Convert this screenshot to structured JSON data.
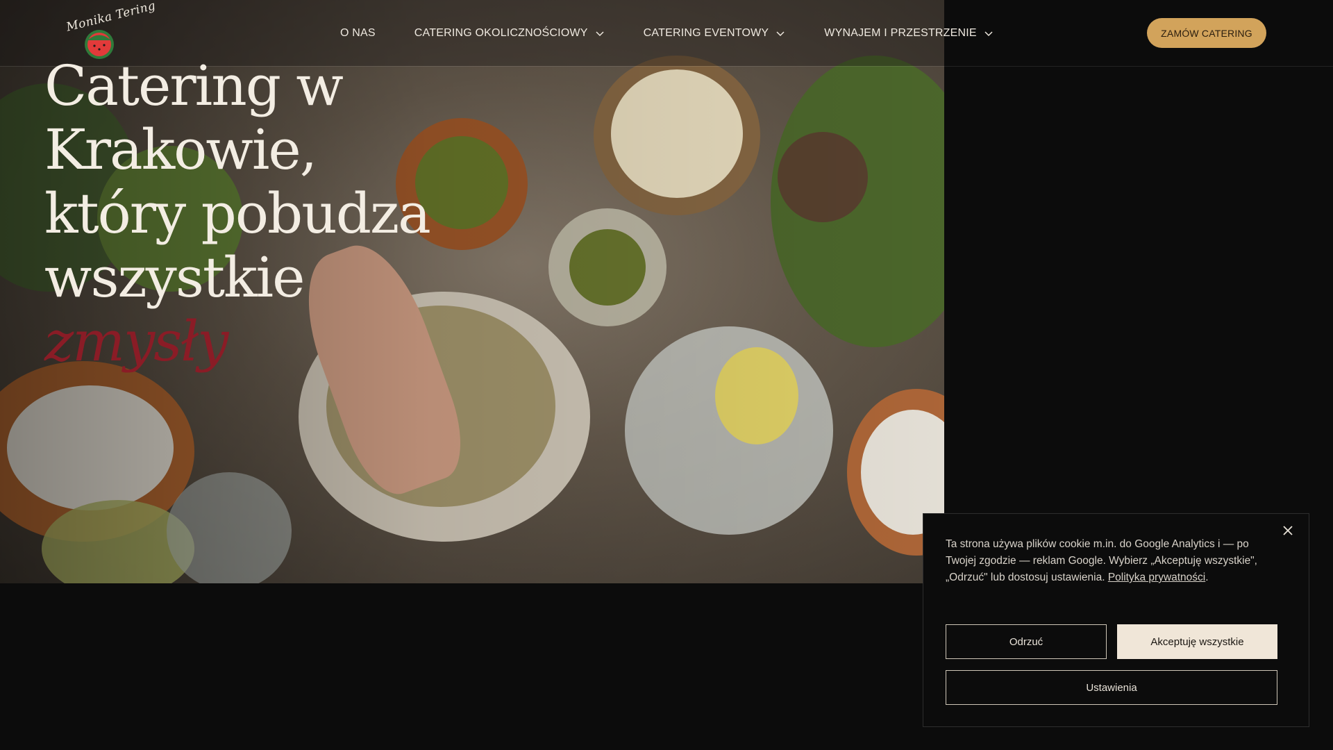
{
  "header": {
    "logo_text": "Monika Tering",
    "nav": [
      {
        "label": "O NAS",
        "has_dropdown": false
      },
      {
        "label": "CATERING OKOLICZNOŚCIOWY",
        "has_dropdown": true
      },
      {
        "label": "CATERING EVENTOWY",
        "has_dropdown": true
      },
      {
        "label": "WYNAJEM I PRZESTRZENIE",
        "has_dropdown": true
      }
    ],
    "cta_label": "ZAMÓW CATERING"
  },
  "hero": {
    "headline_lines": [
      "Catering w",
      "Krakowie,",
      "który pobudza",
      "wszystkie"
    ],
    "headline_accent": "zmysły"
  },
  "cookie": {
    "text": "Ta strona używa plików cookie m.in. do Google Analytics i — po Twojej zgodzie — reklam Google. Wybierz „Akceptuję wszystkie\", „Odrzuć\" lub dostosuj ustawienia.",
    "policy_link": "Polityka prywatności",
    "reject_label": "Odrzuć",
    "accept_label": "Akceptuję wszystkie",
    "settings_label": "Ustawienia"
  },
  "colors": {
    "background": "#0c0c0c",
    "accent_gold": "#d2a35b",
    "accent_red": "#8a1c26",
    "cream": "#f0e6d8"
  }
}
